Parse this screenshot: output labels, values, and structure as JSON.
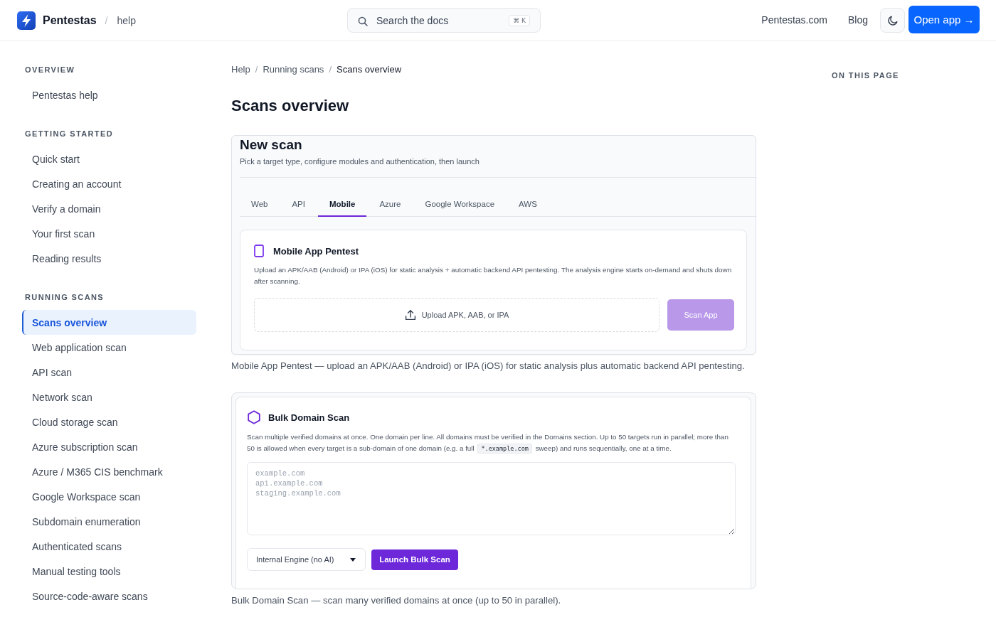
{
  "header": {
    "brand": "Pentestas",
    "separator": "/",
    "section": "help",
    "search": {
      "label": "Search the docs",
      "shortcut": "⌘ K"
    },
    "links": [
      "Pentestas.com",
      "Blog"
    ],
    "open_app": "Open app →"
  },
  "sidebar": {
    "sections": [
      {
        "heading": "OVERVIEW",
        "items": [
          {
            "label": "Pentestas help",
            "selected": false
          }
        ]
      },
      {
        "heading": "GETTING STARTED",
        "items": [
          {
            "label": "Quick start",
            "selected": false
          },
          {
            "label": "Creating an account",
            "selected": false
          },
          {
            "label": "Verify a domain",
            "selected": false
          },
          {
            "label": "Your first scan",
            "selected": false
          },
          {
            "label": "Reading results",
            "selected": false
          }
        ]
      },
      {
        "heading": "RUNNING SCANS",
        "items": [
          {
            "label": "Scans overview",
            "selected": true
          },
          {
            "label": "Web application scan",
            "selected": false
          },
          {
            "label": "API scan",
            "selected": false
          },
          {
            "label": "Network scan",
            "selected": false
          },
          {
            "label": "Cloud storage scan",
            "selected": false
          },
          {
            "label": "Azure subscription scan",
            "selected": false
          },
          {
            "label": "Azure / M365 CIS benchmark",
            "selected": false
          },
          {
            "label": "Google Workspace scan",
            "selected": false
          },
          {
            "label": "Subdomain enumeration",
            "selected": false
          },
          {
            "label": "Authenticated scans",
            "selected": false
          },
          {
            "label": "Manual testing tools",
            "selected": false
          },
          {
            "label": "Source-code-aware scans",
            "selected": false
          }
        ]
      }
    ]
  },
  "breadcrumb": [
    {
      "kind": "link",
      "text": "Help"
    },
    {
      "kind": "separator",
      "text": "/"
    },
    {
      "kind": "link",
      "text": "Running scans"
    },
    {
      "kind": "separator",
      "text": "/"
    },
    {
      "kind": "current",
      "text": "Scans overview"
    }
  ],
  "title": "Scans overview",
  "new_scan": {
    "title": "New scan",
    "subtitle": "Pick a target type, configure modules and authentication, then launch",
    "tabs": [
      {
        "label": "Web",
        "selected": false
      },
      {
        "label": "API",
        "selected": false
      },
      {
        "label": "Mobile",
        "selected": true
      },
      {
        "label": "Azure",
        "selected": false
      },
      {
        "label": "Google Workspace",
        "selected": false
      },
      {
        "label": "AWS",
        "selected": false
      }
    ],
    "panel": {
      "title": "Mobile App Pentest",
      "description": "Upload an APK/AAB (Android) or IPA (iOS) for static analysis + automatic backend API pentesting. The analysis engine starts on-demand and shuts down after scanning.",
      "upload_label": "Upload APK, AAB, or IPA",
      "button": {
        "label": "Scan App",
        "disabled": true
      }
    }
  },
  "new_scan_caption": "Mobile App Pentest — upload an APK/AAB (Android) or IPA (iOS) for static analysis plus automatic backend API pentesting.",
  "bulk_scan": {
    "title": "Bulk Domain Scan",
    "description": [
      {
        "kind": "text",
        "text": "Scan multiple verified domains at once. One domain per line. All domains must be verified in the Domains section. Up to 50 targets run in parallel; more than 50 is allowed when every target is a sub-domain of one domain (e.g. a full "
      },
      {
        "kind": "code",
        "text": "*.example.com"
      },
      {
        "kind": "text",
        "text": " sweep) and runs sequentially, one at a time."
      }
    ],
    "placeholder": "example.com\napi.example.com\nstaging.example.com",
    "engine": {
      "value": "Internal Engine (no AI)"
    },
    "button": {
      "label": "Launch Bulk Scan"
    }
  },
  "bulk_scan_caption": "Bulk Domain Scan — scan many verified domains at once (up to 50 in parallel).",
  "on_this_page": {
    "heading": "ON THIS PAGE"
  }
}
